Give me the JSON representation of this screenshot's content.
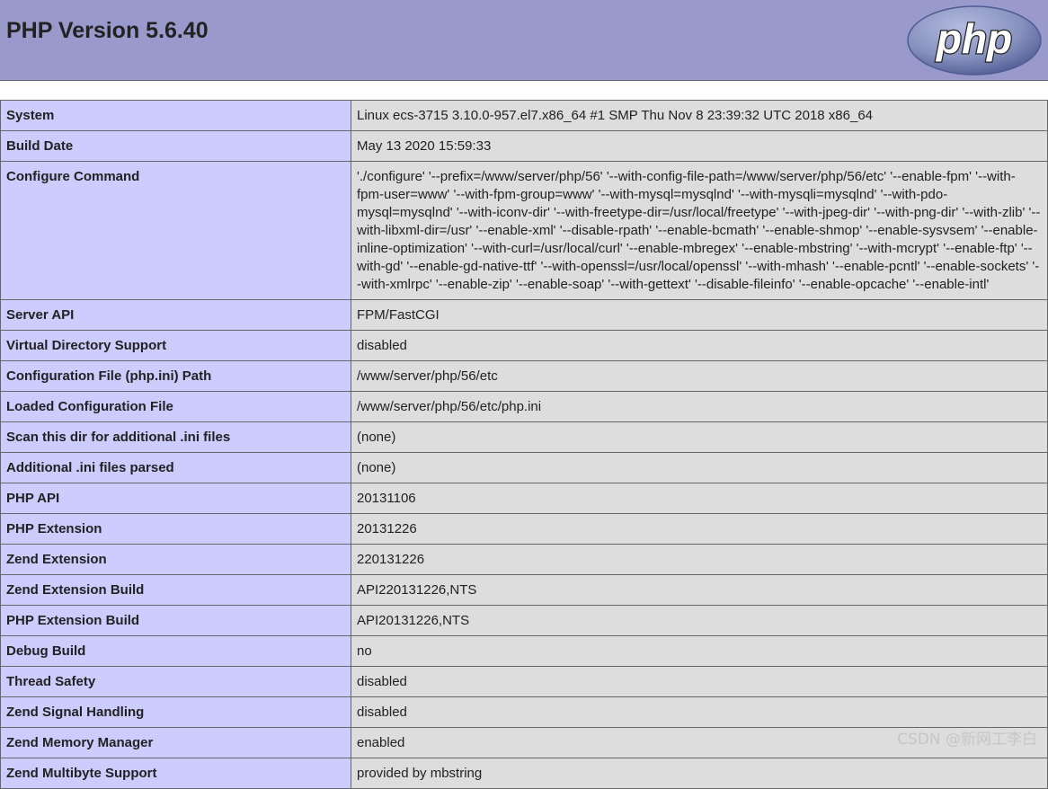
{
  "header": {
    "title": "PHP Version 5.6.40",
    "logo_text": "php"
  },
  "rows": [
    {
      "key": "System",
      "value": "Linux ecs-3715 3.10.0-957.el7.x86_64 #1 SMP Thu Nov 8 23:39:32 UTC 2018 x86_64"
    },
    {
      "key": "Build Date",
      "value": "May 13 2020 15:59:33"
    },
    {
      "key": "Configure Command",
      "value": "'./configure' '--prefix=/www/server/php/56' '--with-config-file-path=/www/server/php/56/etc' '--enable-fpm' '--with-fpm-user=www' '--with-fpm-group=www' '--with-mysql=mysqlnd' '--with-mysqli=mysqlnd' '--with-pdo-mysql=mysqlnd' '--with-iconv-dir' '--with-freetype-dir=/usr/local/freetype' '--with-jpeg-dir' '--with-png-dir' '--with-zlib' '--with-libxml-dir=/usr' '--enable-xml' '--disable-rpath' '--enable-bcmath' '--enable-shmop' '--enable-sysvsem' '--enable-inline-optimization' '--with-curl=/usr/local/curl' '--enable-mbregex' '--enable-mbstring' '--with-mcrypt' '--enable-ftp' '--with-gd' '--enable-gd-native-ttf' '--with-openssl=/usr/local/openssl' '--with-mhash' '--enable-pcntl' '--enable-sockets' '--with-xmlrpc' '--enable-zip' '--enable-soap' '--with-gettext' '--disable-fileinfo' '--enable-opcache' '--enable-intl'"
    },
    {
      "key": "Server API",
      "value": "FPM/FastCGI"
    },
    {
      "key": "Virtual Directory Support",
      "value": "disabled"
    },
    {
      "key": "Configuration File (php.ini) Path",
      "value": "/www/server/php/56/etc"
    },
    {
      "key": "Loaded Configuration File",
      "value": "/www/server/php/56/etc/php.ini"
    },
    {
      "key": "Scan this dir for additional .ini files",
      "value": "(none)"
    },
    {
      "key": "Additional .ini files parsed",
      "value": "(none)"
    },
    {
      "key": "PHP API",
      "value": "20131106"
    },
    {
      "key": "PHP Extension",
      "value": "20131226"
    },
    {
      "key": "Zend Extension",
      "value": "220131226"
    },
    {
      "key": "Zend Extension Build",
      "value": "API220131226,NTS"
    },
    {
      "key": "PHP Extension Build",
      "value": "API20131226,NTS"
    },
    {
      "key": "Debug Build",
      "value": "no"
    },
    {
      "key": "Thread Safety",
      "value": "disabled"
    },
    {
      "key": "Zend Signal Handling",
      "value": "disabled"
    },
    {
      "key": "Zend Memory Manager",
      "value": "enabled"
    },
    {
      "key": "Zend Multibyte Support",
      "value": "provided by mbstring"
    }
  ],
  "watermark": "CSDN @新网工李白",
  "colors": {
    "header_bg": "#9999cc",
    "key_cell_bg": "#ccccff",
    "value_cell_bg": "#dddddd",
    "logo_fill": "#8892bf"
  }
}
